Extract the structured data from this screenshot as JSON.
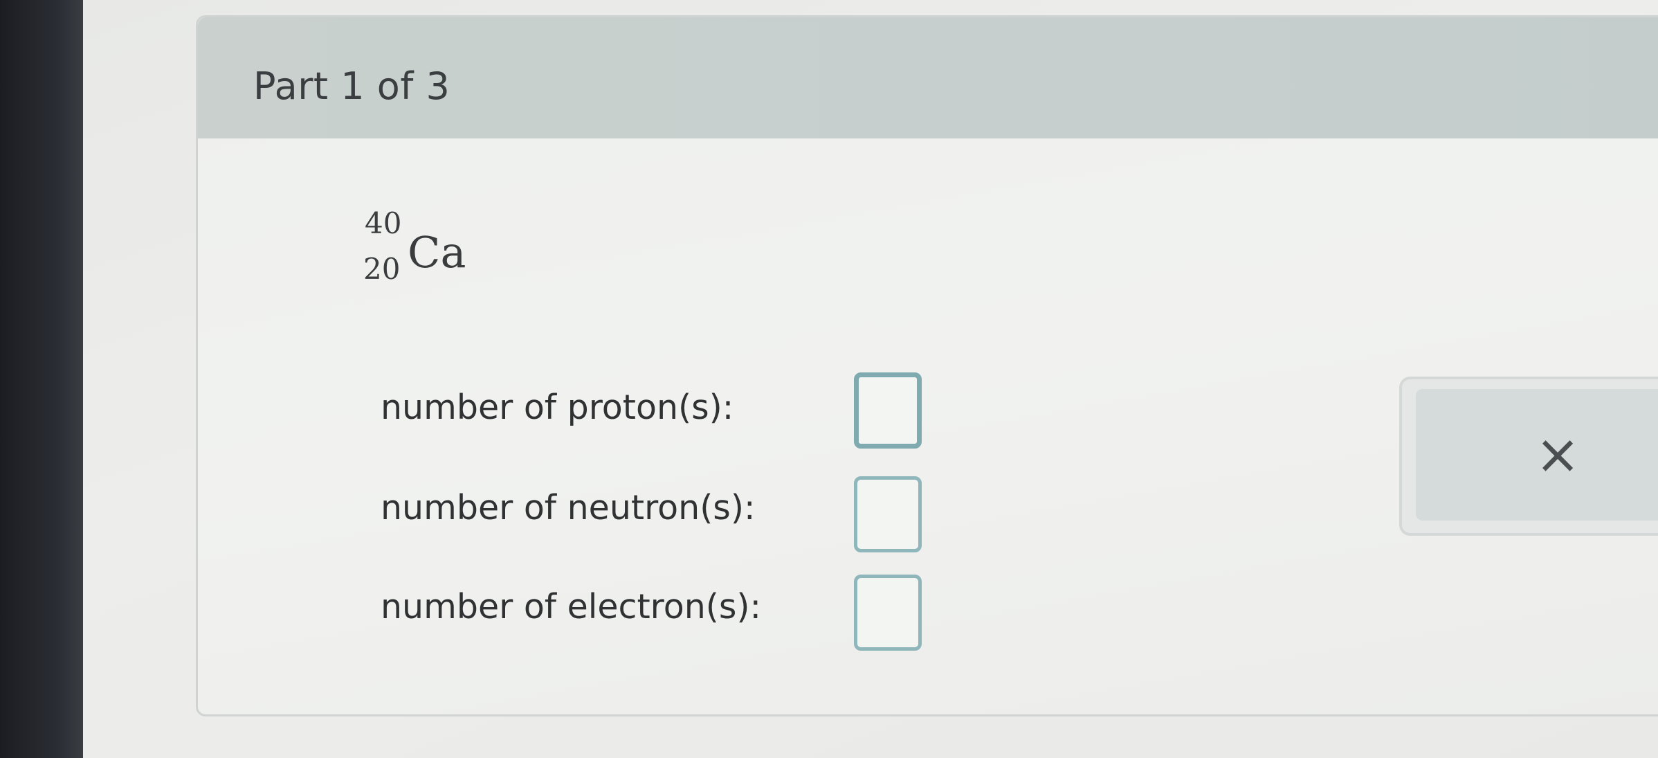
{
  "part": {
    "title": "Part 1 of 3"
  },
  "nuclide": {
    "mass_number": "40",
    "atomic_number": "20",
    "symbol": "Ca"
  },
  "questions": [
    {
      "label": "number of proton(s):",
      "value": ""
    },
    {
      "label": "number of neutron(s):",
      "value": ""
    },
    {
      "label": "number of electron(s):",
      "value": ""
    }
  ],
  "tools": {
    "clear_icon": "close-icon",
    "clear_glyph": "×"
  },
  "colors": {
    "header": "#c8cfce",
    "input_border": "#8fb7bb"
  }
}
